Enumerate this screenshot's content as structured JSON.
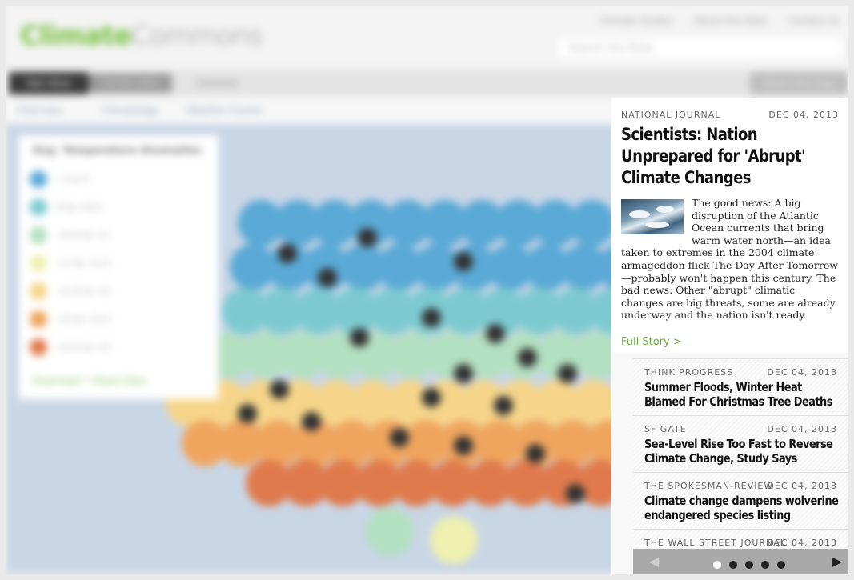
{
  "app": {
    "logo_green": "Climate",
    "logo_grey": "Commons",
    "toplinks": [
      "Climate Guides",
      "About the Atlas",
      "Contact Us"
    ],
    "search_placeholder": "Search the Atlas",
    "nav": [
      "Nat Atlas",
      "Climate Atlas",
      "Extreme"
    ],
    "nav_right": "Share this map",
    "subnav": [
      "Overview",
      "Climatology",
      "Weather Events"
    ],
    "legend_title": "Avg. Temperature Anomalies",
    "legend_items": [
      "-1 to 0",
      "0 to +0.5",
      "+0.5 to +1",
      "+1 to +1.5",
      "+1.5 to +2",
      "+2 to +2.5",
      "+2.5 to +3"
    ],
    "legend_link": "Download • Share Data"
  },
  "featured": {
    "source": "National Journal",
    "date": "DEC 04, 2013",
    "title": "Scientists: Nation Unprepared for 'Abrupt' Climate Changes",
    "body": "The good news: A big disruption of the Atlantic Ocean currents that bring warm water north—an idea taken to extremes in the 2004 climate armageddon flick The Day After Tomorrow—probably won't happen this century. The bad news: Other \"abrupt\" climatic changes are big threats, some are already underway and the nation isn't ready.",
    "link": "Full Story >"
  },
  "news": [
    {
      "source": "Think Progress",
      "date": "DEC 04, 2013",
      "title": "Summer Floods, Winter Heat Blamed For Christmas Tree Deaths"
    },
    {
      "source": "SF Gate",
      "date": "DEC 04, 2013",
      "title": "Sea-Level Rise Too Fast to Reverse Climate Change, Study Says"
    },
    {
      "source": "The Spokesman-Review",
      "date": "DEC 04, 2013",
      "title": "Climate change dampens wolverine endangered species listing"
    },
    {
      "source": "The Wall Street Journal",
      "date": "DEC 04, 2013",
      "title": ""
    }
  ],
  "pager": {
    "prev": "◀",
    "next": "▶",
    "pages": 5,
    "active": 1
  },
  "colors": {
    "brand_green": "#79c142",
    "link_green": "#6cae3b",
    "legend_scale": [
      "#5aa9d6",
      "#7ccad0",
      "#b3e0c0",
      "#eef0b0",
      "#f6d58a",
      "#f0a55e",
      "#e07a4c"
    ]
  }
}
